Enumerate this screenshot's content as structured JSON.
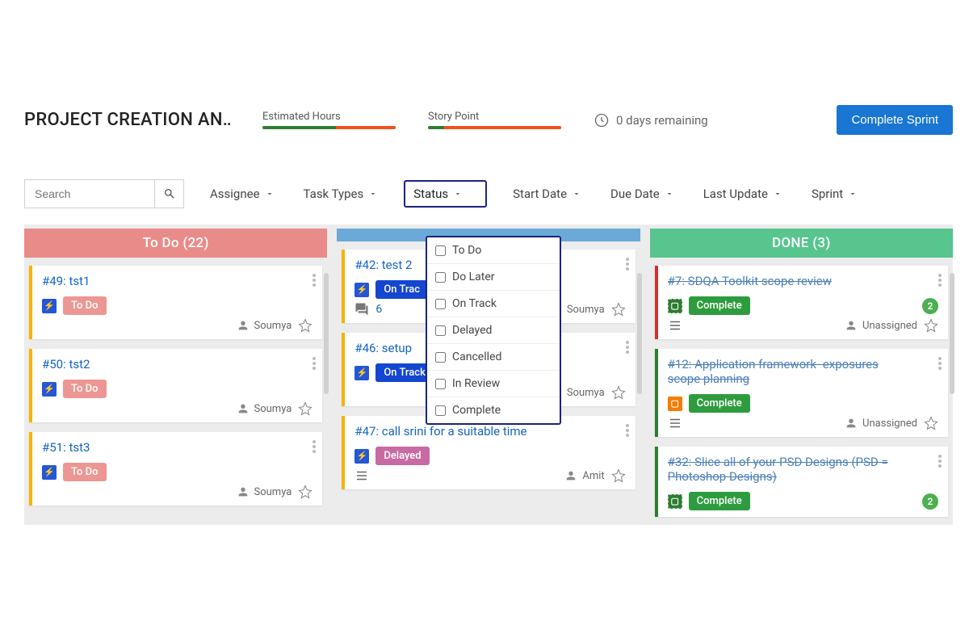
{
  "header": {
    "project_title": "PROJECT CREATION AN…",
    "estimated_hours_label": "Estimated Hours",
    "story_point_label": "Story Point",
    "days_remaining_text": "0 days remaining",
    "complete_sprint_label": "Complete Sprint"
  },
  "filters": {
    "search_placeholder": "Search",
    "assignee": "Assignee",
    "task_types": "Task Types",
    "status": "Status",
    "start_date": "Start Date",
    "due_date": "Due Date",
    "last_update": "Last Update",
    "sprint": "Sprint",
    "status_options": [
      "To Do",
      "Do Later",
      "On Track",
      "Delayed",
      "Cancelled",
      "In Review",
      "Complete"
    ]
  },
  "columns": {
    "todo": {
      "title": "To Do (22)",
      "cards": [
        {
          "title": "#49: tst1",
          "status": "To Do",
          "assignee": "Soumya"
        },
        {
          "title": "#50: tst2",
          "status": "To Do",
          "assignee": "Soumya"
        },
        {
          "title": "#51: tst3",
          "status": "To Do",
          "assignee": "Soumya"
        }
      ]
    },
    "progress": {
      "title": "",
      "cards": [
        {
          "title": "#42: test 2",
          "status": "On Trac",
          "assignee": "Soumya",
          "comments": "6"
        },
        {
          "title": "#46: setup",
          "status": "On Track",
          "assignee": "Soumya"
        },
        {
          "title": "#47: call srini for a suitable time",
          "status": "Delayed",
          "assignee": "Amit"
        }
      ]
    },
    "done": {
      "title": "DONE (3)",
      "cards": [
        {
          "title": "#7: SDQA Toolkit scope review",
          "status": "Complete",
          "assignee": "Unassigned",
          "count": "2"
        },
        {
          "title": "#12: Application framework- exposures scope planning",
          "status": "Complete",
          "assignee": "Unassigned"
        },
        {
          "title": "#32: Slice all of your PSD Designs (PSD = Photoshop Designs)",
          "status": "Complete",
          "count": "2"
        }
      ]
    }
  }
}
